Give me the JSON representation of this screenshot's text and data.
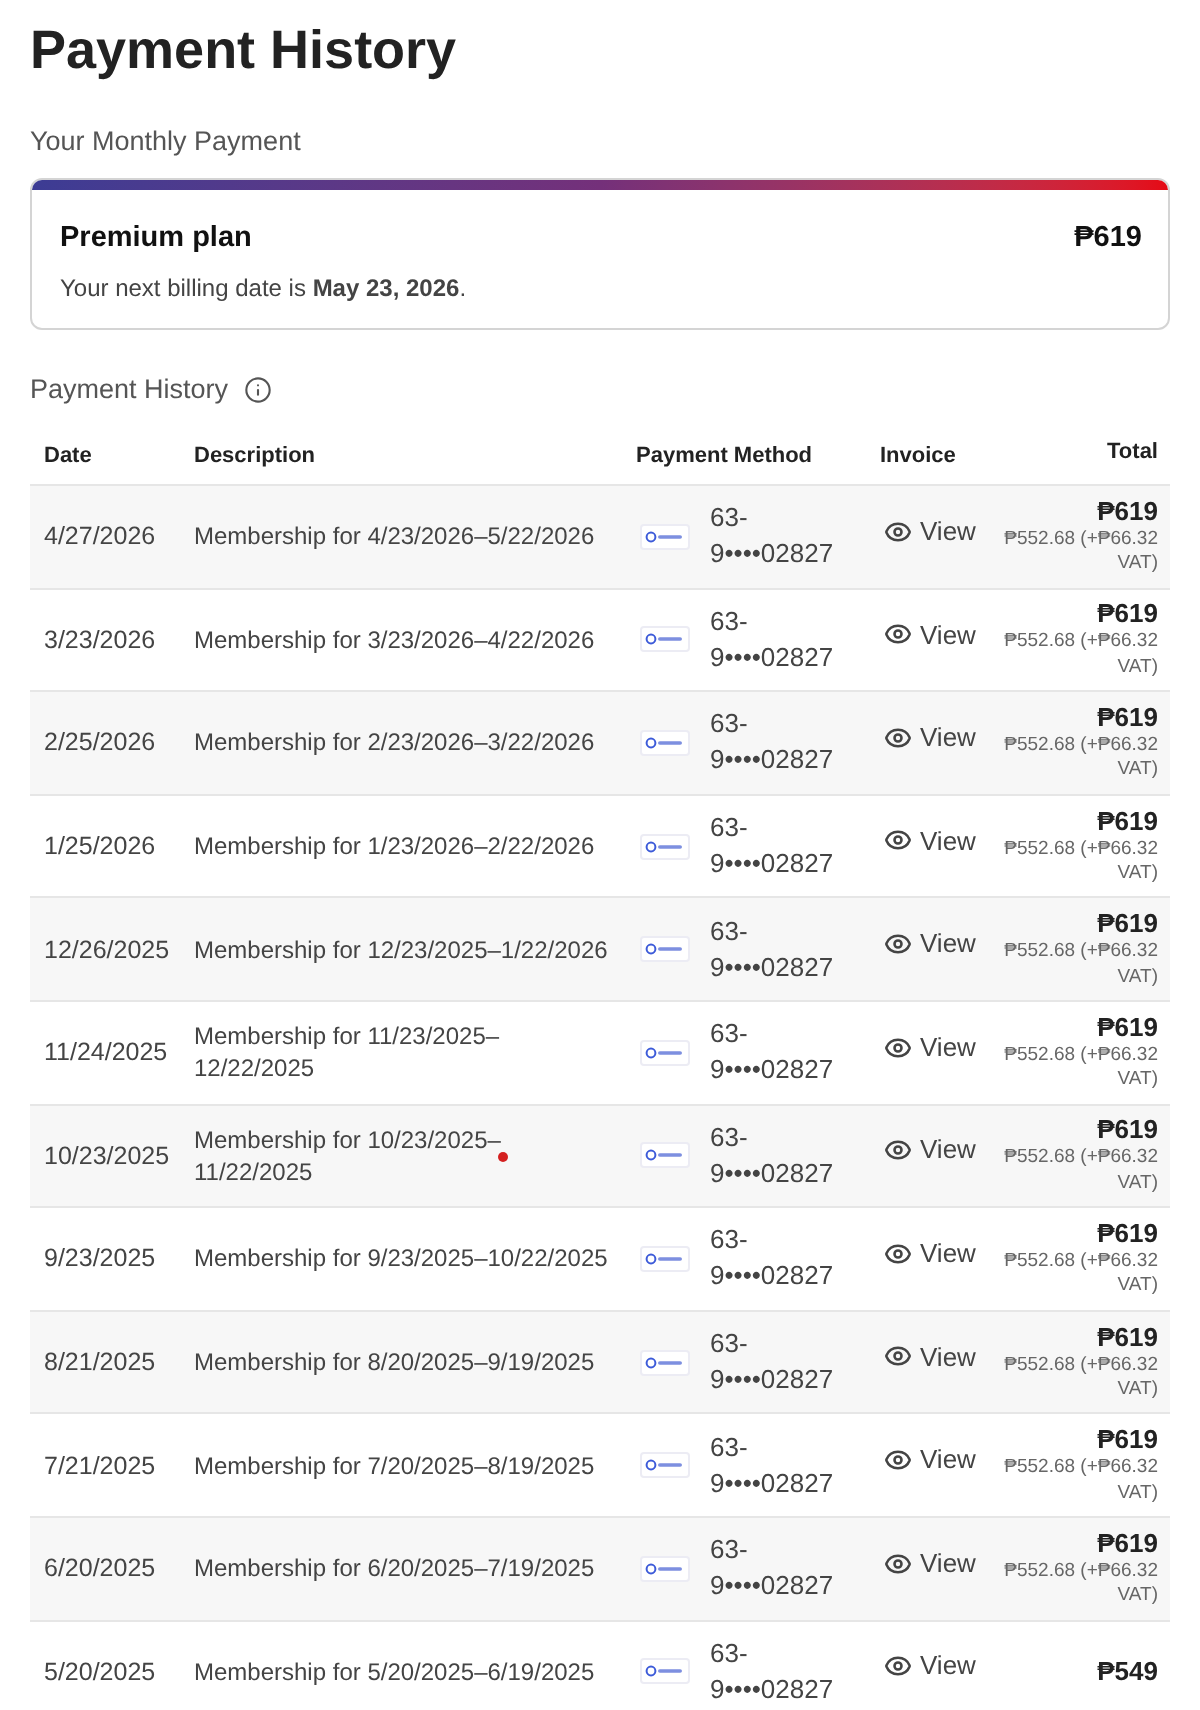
{
  "page": {
    "title": "Payment History"
  },
  "monthly_payment": {
    "heading": "Your Monthly Payment",
    "plan": "Premium plan",
    "price": "₱619",
    "billing_note": "Your next billing date is **May 23, 2026**."
  },
  "history": {
    "heading": "Payment History",
    "columns": [
      "Date",
      "Description",
      "Payment Method",
      "Invoice",
      "Total"
    ],
    "rows": [
      {
        "date": "4/27/2026",
        "description": "Membership for 4/23/2026–5/22/2026",
        "payment_method": "63-9••••02827",
        "invoice": "View",
        "total": "₱619",
        "total_detail": "₱552.68 (+₱66.32 VAT)",
        "marked": false
      },
      {
        "date": "3/23/2026",
        "description": "Membership for 3/23/2026–4/22/2026",
        "payment_method": "63-9••••02827",
        "invoice": "View",
        "total": "₱619",
        "total_detail": "₱552.68 (+₱66.32 VAT)",
        "marked": false
      },
      {
        "date": "2/25/2026",
        "description": "Membership for 2/23/2026–3/22/2026",
        "payment_method": "63-9••••02827",
        "invoice": "View",
        "total": "₱619",
        "total_detail": "₱552.68 (+₱66.32 VAT)",
        "marked": false
      },
      {
        "date": "1/25/2026",
        "description": "Membership for 1/23/2026–2/22/2026",
        "payment_method": "63-9••••02827",
        "invoice": "View",
        "total": "₱619",
        "total_detail": "₱552.68 (+₱66.32 VAT)",
        "marked": false
      },
      {
        "date": "12/26/2025",
        "description": "Membership for 12/23/2025–1/22/2026",
        "payment_method": "63-9••••02827",
        "invoice": "View",
        "total": "₱619",
        "total_detail": "₱552.68 (+₱66.32 VAT)",
        "marked": false
      },
      {
        "date": "11/24/2025",
        "description": "Membership for 11/23/2025–12/22/2025",
        "payment_method": "63-9••••02827",
        "invoice": "View",
        "total": "₱619",
        "total_detail": "₱552.68 (+₱66.32 VAT)",
        "marked": false
      },
      {
        "date": "10/23/2025",
        "description": "Membership for 10/23/2025–11/22/2025",
        "payment_method": "63-9••••02827",
        "invoice": "View",
        "total": "₱619",
        "total_detail": "₱552.68 (+₱66.32 VAT)",
        "marked": true
      },
      {
        "date": "9/23/2025",
        "description": "Membership for 9/23/2025–10/22/2025",
        "payment_method": "63-9••••02827",
        "invoice": "View",
        "total": "₱619",
        "total_detail": "₱552.68 (+₱66.32 VAT)",
        "marked": false
      },
      {
        "date": "8/21/2025",
        "description": "Membership for 8/20/2025–9/19/2025",
        "payment_method": "63-9••••02827",
        "invoice": "View",
        "total": "₱619",
        "total_detail": "₱552.68 (+₱66.32 VAT)",
        "marked": false
      },
      {
        "date": "7/21/2025",
        "description": "Membership for 7/20/2025–8/19/2025",
        "payment_method": "63-9••••02827",
        "invoice": "View",
        "total": "₱619",
        "total_detail": "₱552.68 (+₱66.32 VAT)",
        "marked": false
      },
      {
        "date": "6/20/2025",
        "description": "Membership for 6/20/2025–7/19/2025",
        "payment_method": "63-9••••02827",
        "invoice": "View",
        "total": "₱619",
        "total_detail": "₱552.68 (+₱66.32 VAT)",
        "marked": false
      },
      {
        "date": "5/20/2025",
        "description": "Membership for 5/20/2025–6/19/2025",
        "payment_method": "63-9••••02827",
        "invoice": "View",
        "total": "₱549",
        "marked": false
      }
    ]
  }
}
